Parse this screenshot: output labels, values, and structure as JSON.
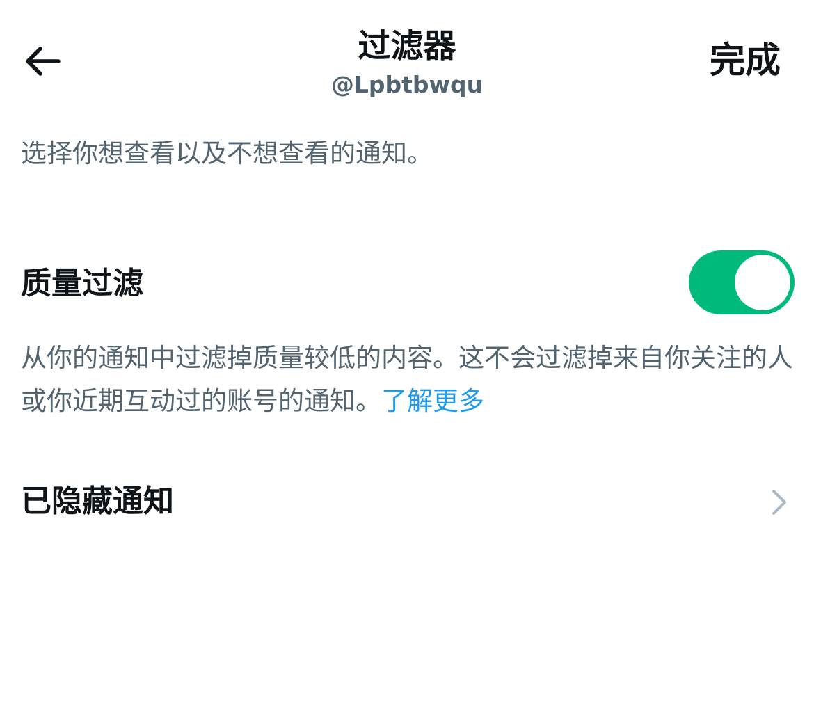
{
  "header": {
    "title": "过滤器",
    "subtitle": "@Lpbtbwqu",
    "done_label": "完成",
    "back_icon": "arrow-left-icon"
  },
  "intro": {
    "text": "选择你想查看以及不想查看的通知。"
  },
  "quality_filter": {
    "label": "质量过滤",
    "enabled": true,
    "toggle_color": "#00ba7c",
    "description": "从你的通知中过滤掉质量较低的内容。这不会过滤掉来自你关注的人或你近期互动过的账号的通知。",
    "learn_more": "了解更多",
    "learn_more_color": "#1d9bf0"
  },
  "hidden_notifications": {
    "label": "已隐藏通知",
    "icon": "chevron-right-icon"
  }
}
